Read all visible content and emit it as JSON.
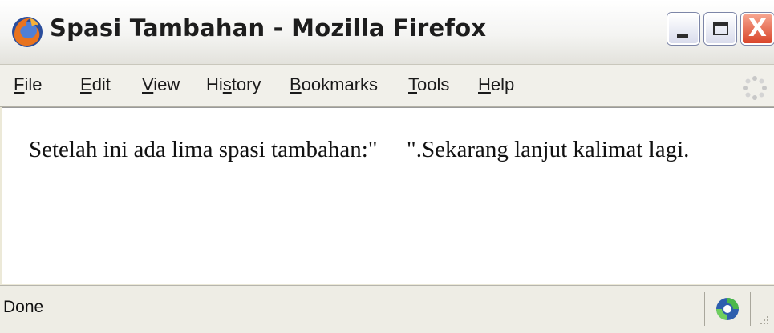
{
  "window": {
    "title": "Spasi Tambahan - Mozilla Firefox",
    "close_glyph": "X"
  },
  "menu": {
    "items": [
      {
        "pre": "",
        "mnemonic": "F",
        "post": "ile"
      },
      {
        "pre": "",
        "mnemonic": "E",
        "post": "dit"
      },
      {
        "pre": "",
        "mnemonic": "V",
        "post": "iew"
      },
      {
        "pre": "Hi",
        "mnemonic": "s",
        "post": "tory"
      },
      {
        "pre": "",
        "mnemonic": "B",
        "post": "ookmarks"
      },
      {
        "pre": "",
        "mnemonic": "T",
        "post": "ools"
      },
      {
        "pre": "",
        "mnemonic": "H",
        "post": "elp"
      }
    ]
  },
  "page": {
    "text": "Setelah ini ada lima spasi tambahan:\"     \".Sekarang lanjut kalimat lagi."
  },
  "status": {
    "text": "Done"
  },
  "icons": {
    "app": "firefox-icon",
    "throbber": "throbber-icon",
    "status": "network-status-icon",
    "grip": "resize-grip-icon"
  },
  "colors": {
    "close_button": "#d9452a",
    "titlebar_bg": "#f4f4f2",
    "chrome_bg": "#ece9d8"
  }
}
